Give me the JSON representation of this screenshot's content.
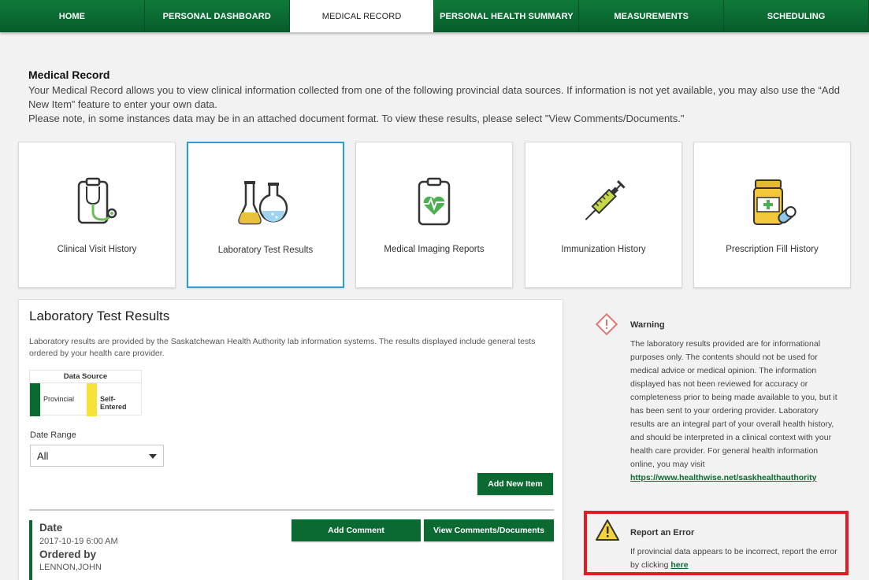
{
  "nav": {
    "tabs": [
      {
        "label": "HOME"
      },
      {
        "label": "PERSONAL DASHBOARD"
      },
      {
        "label": "MEDICAL RECORD"
      },
      {
        "label": "PERSONAL HEALTH SUMMARY"
      },
      {
        "label": "MEASUREMENTS"
      },
      {
        "label": "SCHEDULING"
      }
    ],
    "active": "MEDICAL RECORD"
  },
  "intro": {
    "title": "Medical Record",
    "line1": "Your Medical Record allows you to view clinical information collected from one of the following provincial data sources. If information is not yet available, you may also use the “Add New Item” feature to enter your own data.",
    "line2": "Please note, in some instances data may be in an attached document format. To view these results, please select \"View Comments/Documents.\""
  },
  "cards": [
    {
      "label": "Clinical Visit History",
      "icon": "clipboard-stethoscope-icon"
    },
    {
      "label": "Laboratory Test Results",
      "icon": "lab-flasks-icon"
    },
    {
      "label": "Medical Imaging Reports",
      "icon": "heart-monitor-clipboard-icon"
    },
    {
      "label": "Immunization History",
      "icon": "syringe-icon"
    },
    {
      "label": "Prescription Fill History",
      "icon": "pill-bottle-icon"
    }
  ],
  "selected_card": "Laboratory Test Results",
  "panel": {
    "title": "Laboratory Test Results",
    "description": "Laboratory results are provided by the Saskatchewan Health Authority lab information systems. The results displayed include general tests ordered by your health care provider.",
    "legend": {
      "title": "Data Source",
      "provincial": "Provincial",
      "self_entered": "Self-Entered",
      "provincial_color": "#0b6a32",
      "self_entered_color": "#f5e33a"
    },
    "date_range": {
      "label": "Date Range",
      "value": "All"
    },
    "add_new_item": "Add New Item",
    "record": {
      "date_heading": "Date",
      "date_value": "2017-10-19 6:00 AM",
      "ordered_heading": "Ordered by",
      "ordered_value": "LENNON,JOHN",
      "add_comment": "Add Comment",
      "view_docs": "View Comments/Documents"
    }
  },
  "warning": {
    "title": "Warning",
    "body": "The laboratory results provided are for informational purposes only. The contents should not be used for medical advice or medical opinion. The information displayed has not been reviewed for accuracy or completeness prior to being made available to you, but it has been sent to your ordering provider. Laboratory results are an integral part of your overall health history, and should be interpreted in a clinical context with your health care provider. For general health information online, you may visit",
    "link": "https://www.healthwise.net/saskhealthauthority"
  },
  "report": {
    "title": "Report an Error",
    "body": "If provincial data appears to be incorrect, report the error by clicking",
    "link": "here"
  },
  "colors": {
    "brand_green": "#0b6a32",
    "selected_border": "#2a9fd6",
    "report_border": "#e21b25"
  }
}
